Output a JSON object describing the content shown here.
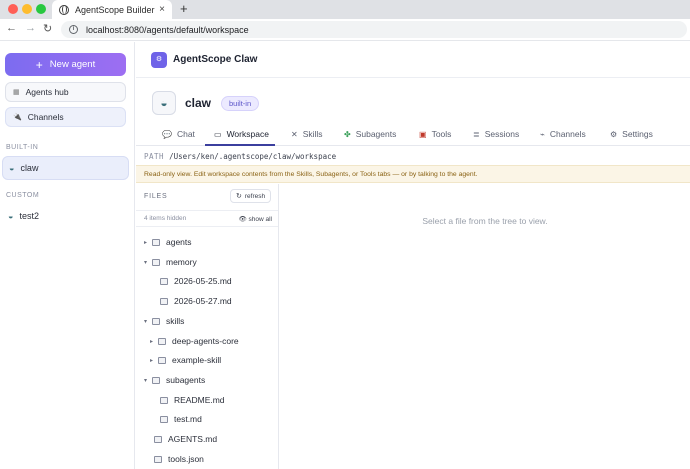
{
  "browser": {
    "tab_title": "AgentScope Builder",
    "tab_close": "×",
    "new_tab": "+",
    "back": "←",
    "forward": "→",
    "reload": "↻",
    "url": "localhost:8080/agents/default/workspace"
  },
  "sidebar": {
    "new_agent_label": "New agent",
    "agents_hub_label": "Agents hub",
    "channels_label": "Channels",
    "builtin_section": "BUILT-IN",
    "custom_section": "CUSTOM",
    "builtin_agents": [
      {
        "name": "claw",
        "selected": true
      }
    ],
    "custom_agents": [
      {
        "name": "test2"
      }
    ]
  },
  "header": {
    "app_title": "AgentScope Claw"
  },
  "agent": {
    "name": "claw",
    "badge": "built-in"
  },
  "tabs": [
    {
      "label": "Chat",
      "icon": "chat-icon",
      "active": false
    },
    {
      "label": "Workspace",
      "icon": "workspace-icon",
      "active": true
    },
    {
      "label": "Skills",
      "icon": "tools-icon",
      "active": false
    },
    {
      "label": "Subagents",
      "icon": "puzzle-icon",
      "active": false
    },
    {
      "label": "Tools",
      "icon": "toolbox-icon",
      "active": false
    },
    {
      "label": "Sessions",
      "icon": "list-icon",
      "active": false
    },
    {
      "label": "Channels",
      "icon": "channels-icon",
      "active": false
    },
    {
      "label": "Settings",
      "icon": "gear-icon",
      "active": false
    }
  ],
  "workspace": {
    "path_label": "PATH",
    "path": "/Users/ken/.agentscope/claw/workspace",
    "notice": "Read-only view. Edit workspace contents from the Skills, Subagents, or Tools tabs — or by talking to the agent.",
    "files_title": "FILES",
    "refresh_label": "refresh",
    "hidden_count": "4 items hidden",
    "show_all": "show all",
    "empty_viewer": "Select a file from the tree to view.",
    "tree": [
      {
        "name": "agents",
        "type": "folder",
        "expanded": false
      },
      {
        "name": "memory",
        "type": "folder",
        "expanded": true
      },
      {
        "name": "2026-05-25.md",
        "type": "file"
      },
      {
        "name": "2026-05-27.md",
        "type": "file"
      },
      {
        "name": "skills",
        "type": "folder",
        "expanded": true
      },
      {
        "name": "deep-agents-core",
        "type": "folder",
        "expanded": false
      },
      {
        "name": "example-skill",
        "type": "folder",
        "expanded": false
      },
      {
        "name": "subagents",
        "type": "folder",
        "expanded": true
      },
      {
        "name": "README.md",
        "type": "file"
      },
      {
        "name": "test.md",
        "type": "file"
      },
      {
        "name": "AGENTS.md",
        "type": "file"
      },
      {
        "name": "tools.json",
        "type": "file"
      }
    ]
  }
}
